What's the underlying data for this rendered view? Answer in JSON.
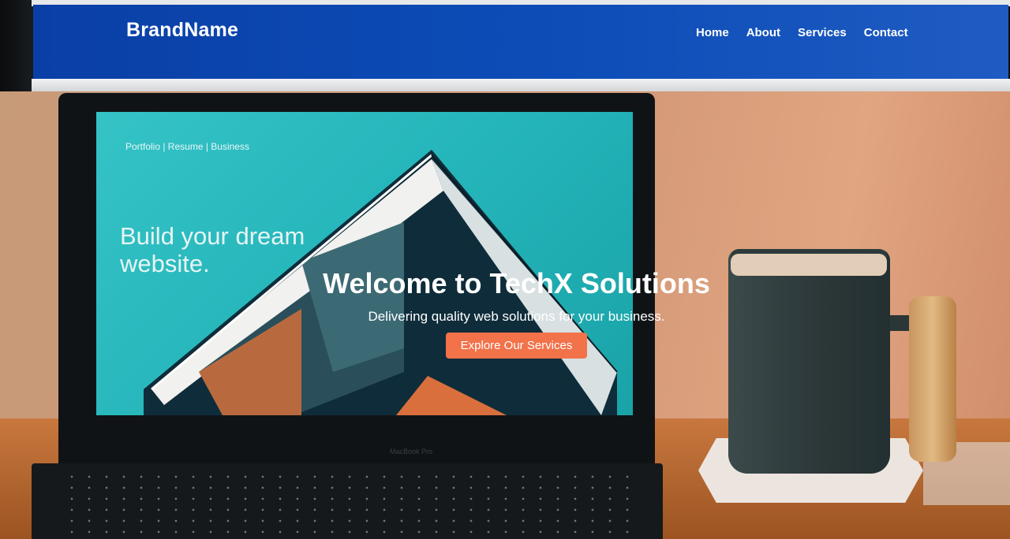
{
  "nav": {
    "brand": "BrandName",
    "links": [
      "Home",
      "About",
      "Services",
      "Contact"
    ]
  },
  "laptop_screen": {
    "tags": "Portfolio | Resume | Business",
    "headline_line1": "Build your dream",
    "headline_line2": "website.",
    "device_label": "MacBook Pro"
  },
  "hero": {
    "title": "Welcome to TechX Solutions",
    "subtitle": "Delivering quality web solutions for your business.",
    "cta_label": "Explore Our Services"
  },
  "colors": {
    "navbar": "#0d4db8",
    "cta": "#f2724a",
    "screen": "#24b5ba"
  }
}
